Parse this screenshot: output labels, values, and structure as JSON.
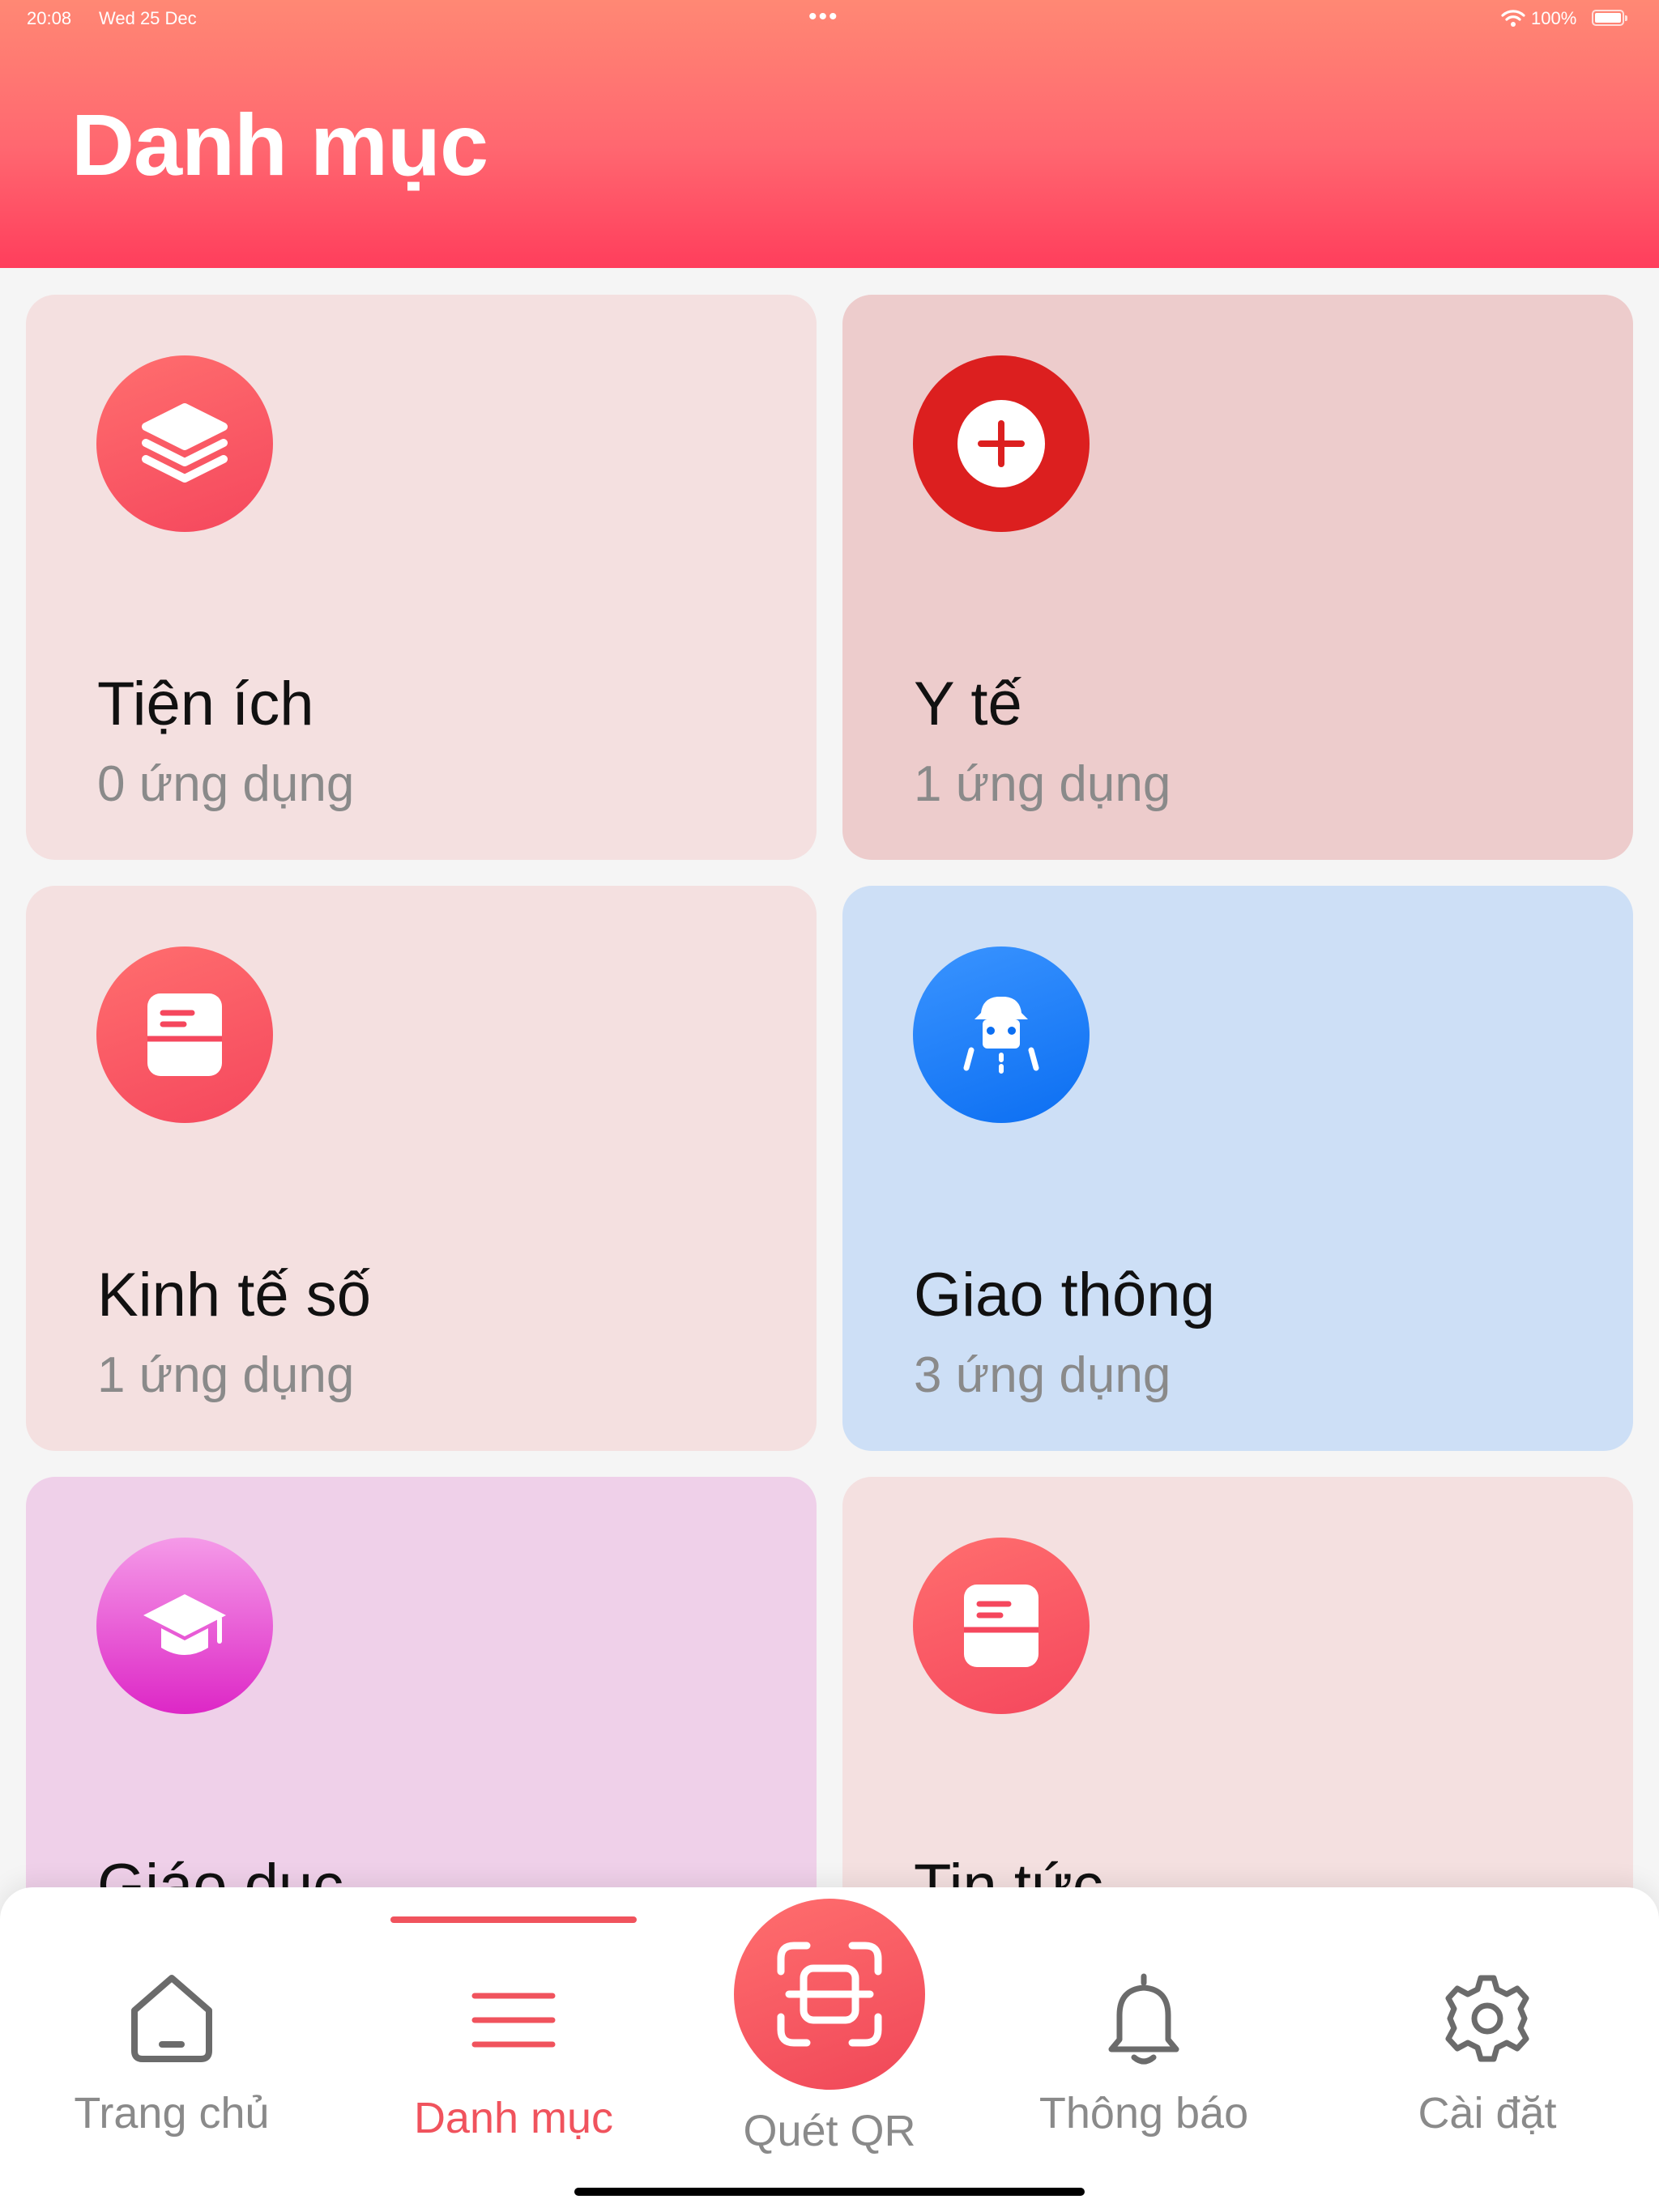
{
  "status_bar": {
    "time": "20:08",
    "date": "Wed 25 Dec",
    "battery": "100%"
  },
  "header": {
    "title": "Danh mục"
  },
  "categories": [
    {
      "title": "Tiện ích",
      "count": "0 ứng dụng",
      "icon": "layers-icon",
      "color": "#f4e0e0"
    },
    {
      "title": "Y tế",
      "count": "1 ứng dụng",
      "icon": "medical-plus-icon",
      "color": "#edcccc"
    },
    {
      "title": "Kinh tế số",
      "count": "1 ứng dụng",
      "icon": "document-icon",
      "color": "#f4e0e0"
    },
    {
      "title": "Giao thông",
      "count": "3 ứng dụng",
      "icon": "car-road-icon",
      "color": "#cddff6"
    },
    {
      "title": "Giáo dục",
      "count": "",
      "icon": "graduation-cap-icon",
      "color": "#efd0e9"
    },
    {
      "title": "Tin tức",
      "count": "",
      "icon": "news-icon",
      "color": "#f4e0e0"
    }
  ],
  "tabbar": {
    "items": [
      {
        "label": "Trang chủ",
        "icon": "home-icon"
      },
      {
        "label": "Danh mục",
        "icon": "menu-icon",
        "active": true
      },
      {
        "label": "Quét QR",
        "icon": "qr-scan-icon"
      },
      {
        "label": "Thông báo",
        "icon": "bell-icon"
      },
      {
        "label": "Cài đặt",
        "icon": "gear-icon"
      }
    ],
    "active_color": "#f0535d"
  },
  "colors": {
    "header_gradient_top": "#ff8874",
    "header_gradient_bottom": "#ff3e5c",
    "accent": "#f0535d"
  }
}
